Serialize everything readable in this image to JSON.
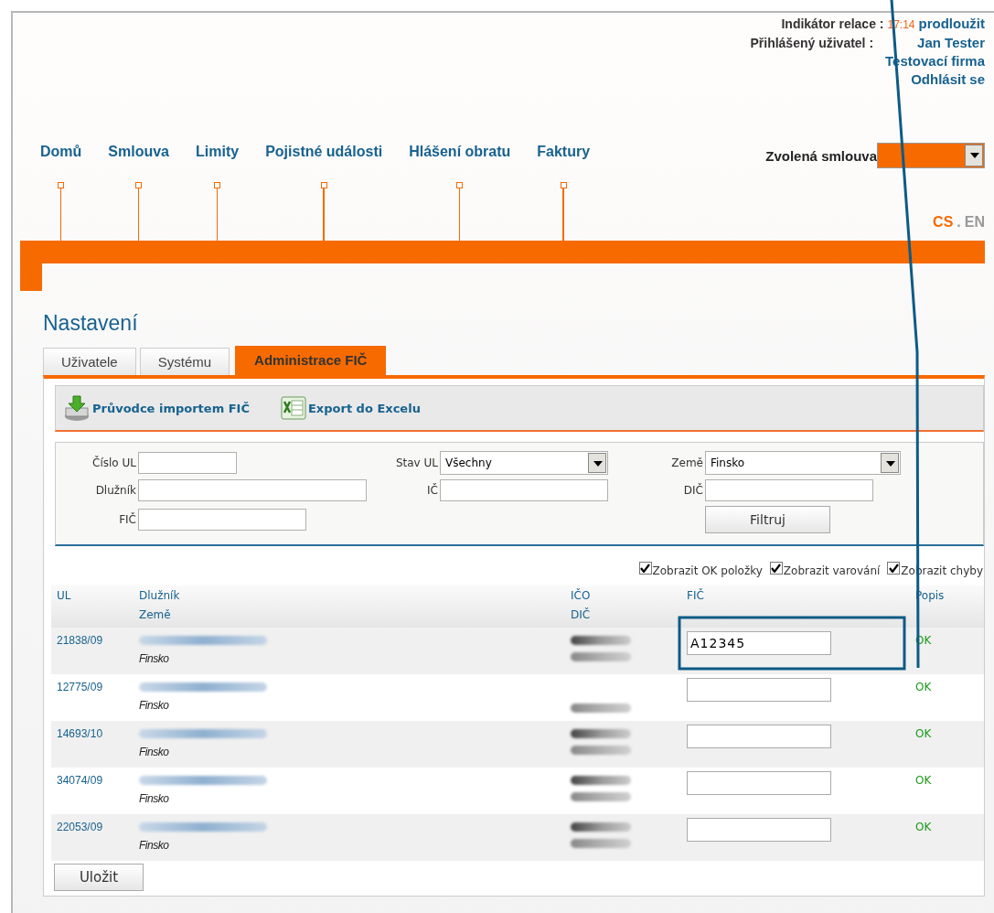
{
  "session": {
    "label": "Indikátor relace :",
    "time": "17:14",
    "extend": "prodloužit"
  },
  "user": {
    "label": "Přihlášený uživatel :",
    "name": "Jan Tester",
    "company": "Testovací firma",
    "logout": "Odhlásit se"
  },
  "nav": [
    {
      "label": "Domů"
    },
    {
      "label": "Smlouva"
    },
    {
      "label": "Limity"
    },
    {
      "label": "Pojistné události"
    },
    {
      "label": "Hlášení obratu"
    },
    {
      "label": "Faktury"
    }
  ],
  "contract_select": {
    "label": "Zvolená smlouva"
  },
  "languages": [
    {
      "label": "CS",
      "selected": true
    },
    {
      "label": "EN",
      "selected": false
    }
  ],
  "language_separator": ".",
  "page_title": "Nastavení",
  "tabs": [
    {
      "label": "Uživatele",
      "selected": false
    },
    {
      "label": "Systému",
      "selected": false
    },
    {
      "label": "Administrace FIČ",
      "selected": true
    }
  ],
  "toolbar": [
    {
      "kind": "import",
      "label": "Průvodce importem FIČ"
    },
    {
      "kind": "excel",
      "label": "Export do Excelu"
    }
  ],
  "filters": [
    {
      "kind": "text",
      "label": "Číslo UL"
    },
    {
      "kind": "select",
      "label": "Stav UL",
      "value": "Všechny"
    },
    {
      "kind": "select",
      "label": "Země",
      "value": "Finsko"
    },
    {
      "kind": "text",
      "label": "Dlužník"
    },
    {
      "kind": "text",
      "label": "IČ"
    },
    {
      "kind": "text",
      "label": "DIČ"
    },
    {
      "kind": "text",
      "label": "FIČ"
    },
    {
      "kind": "empty"
    },
    {
      "kind": "button",
      "label": "Filtruj"
    }
  ],
  "toggles": [
    {
      "label": "Zobrazit OK položky",
      "checked": true
    },
    {
      "label": "Zobrazit varování",
      "checked": true
    },
    {
      "label": "Zobrazit chyby",
      "checked": true
    }
  ],
  "table": {
    "columns": [
      {
        "top": "UL"
      },
      {
        "top": "Dlužník",
        "bottom": "Země"
      },
      {
        "top": "IČO",
        "bottom": "DIČ"
      },
      {
        "top": "FIČ"
      },
      {
        "top": "Popis"
      }
    ],
    "rows": [
      {
        "ul": "21838/09",
        "country": "Finsko",
        "debtor_blurred": true,
        "ico_blurred": true,
        "dic_blurred": true,
        "fic": "A12345",
        "status": "OK"
      },
      {
        "ul": "12775/09",
        "country": "Finsko",
        "debtor_blurred": true,
        "ico_blurred": false,
        "dic_blurred": true,
        "fic": "",
        "status": "OK"
      },
      {
        "ul": "14693/10",
        "country": "Finsko",
        "debtor_blurred": true,
        "ico_blurred": true,
        "dic_blurred": true,
        "fic": "",
        "status": "OK"
      },
      {
        "ul": "34074/09",
        "country": "Finsko",
        "debtor_blurred": true,
        "ico_blurred": true,
        "dic_blurred": true,
        "fic": "",
        "status": "OK"
      },
      {
        "ul": "22053/09",
        "country": "Finsko",
        "debtor_blurred": true,
        "ico_blurred": true,
        "dic_blurred": true,
        "fic": "",
        "status": "OK"
      }
    ]
  },
  "save_button": "Uložit"
}
